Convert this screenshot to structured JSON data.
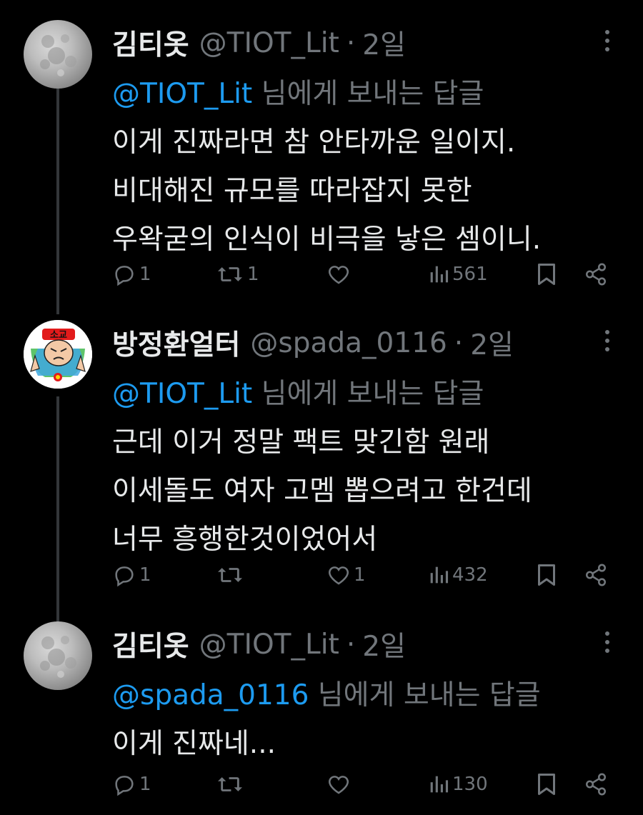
{
  "tweets": [
    {
      "display_name": "김티옷",
      "handle": "@TIOT_Lit",
      "dot": "·",
      "time": "2일",
      "reply_mention": "@TIOT_Lit",
      "reply_suffix": " 님에게 보내는 답글",
      "lines": [
        "이게 진짜라면 참 안타까운 일이지.",
        "비대해진 규모를 따라잡지 못한",
        "우왁굳의 인식이 비극을 낳은 셈이니."
      ],
      "avatar_icon": "moon-avatar",
      "replies": "1",
      "retweets": "1",
      "likes": "",
      "views": "561"
    },
    {
      "display_name": "방정환얼터",
      "handle": "@spada_0116",
      "dot": "·",
      "time": "2일",
      "reply_mention": "@TIOT_Lit",
      "reply_suffix": " 님에게 보내는 답글",
      "lines": [
        "근데 이거 정말 팩트 맞긴함 원래",
        "이세돌도 여자 고멤 뽑으려고 한건데",
        "너무 흥행한것이었어서"
      ],
      "avatar_icon": "cartoon-avatar",
      "avatar_text": "소교",
      "replies": "1",
      "retweets": "",
      "likes": "1",
      "views": "432"
    },
    {
      "display_name": "김티옷",
      "handle": "@TIOT_Lit",
      "dot": "·",
      "time": "2일",
      "reply_mention": "@spada_0116",
      "reply_suffix": " 님에게 보내는 답글",
      "lines": [
        "이게 진짜네..."
      ],
      "avatar_icon": "moon-avatar",
      "replies": "1",
      "retweets": "",
      "likes": "",
      "views": "130"
    }
  ],
  "colors": {
    "background": "#000000",
    "text": "#e7e9ea",
    "secondary": "#71767b",
    "accent": "#1d9bf0",
    "thread_line": "#333639"
  },
  "icons": [
    "reply-icon",
    "retweet-icon",
    "like-icon",
    "views-icon",
    "bookmark-icon",
    "share-icon",
    "more-icon"
  ]
}
